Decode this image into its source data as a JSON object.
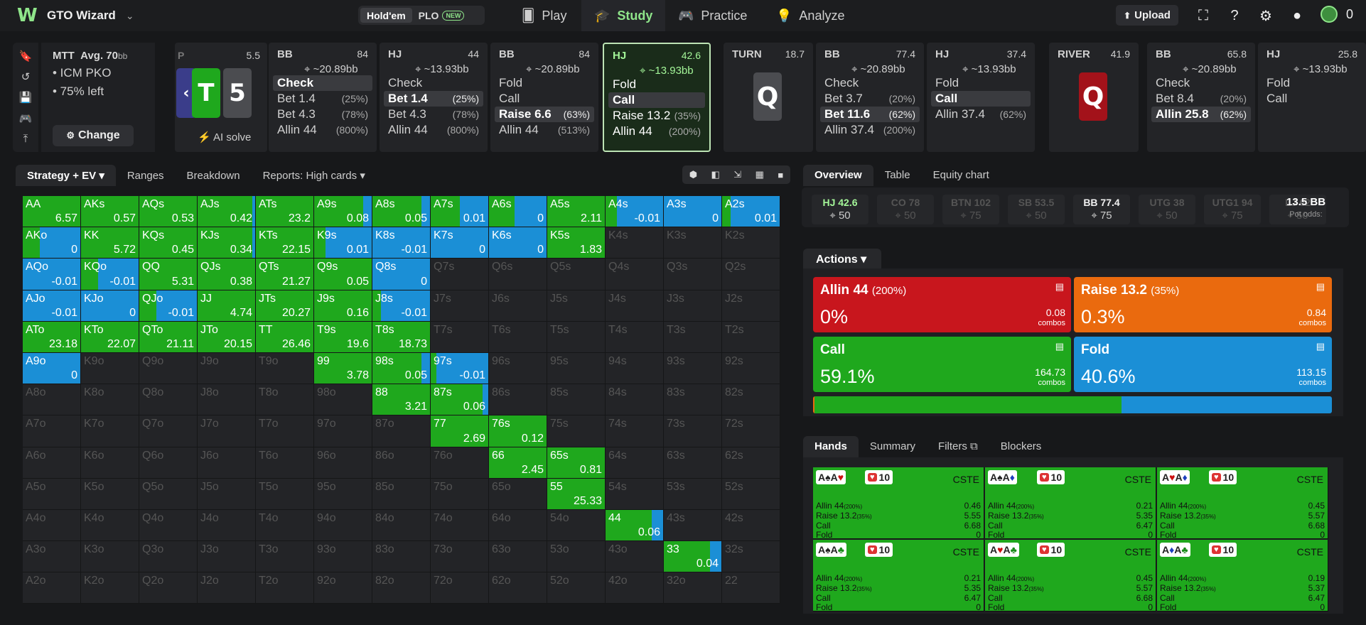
{
  "app": {
    "brand": "GTO Wizard",
    "game_toggle": [
      "Hold'em",
      "PLO"
    ],
    "new_badge": "NEW"
  },
  "nav": [
    {
      "label": "Play",
      "icon": "cards-icon"
    },
    {
      "label": "Study",
      "icon": "graduation-cap-icon"
    },
    {
      "label": "Practice",
      "icon": "gamepad-icon"
    },
    {
      "label": "Analyze",
      "icon": "lightbulb-icon"
    }
  ],
  "upload": "Upload",
  "coins": "0",
  "mtt": {
    "title": "MTT",
    "avg": "Avg. 70",
    "avg_unit": "bb",
    "line1": "• ICM PKO",
    "line2": "• 75% left",
    "change": "Change"
  },
  "flop": {
    "tag": "5.5",
    "p": "P",
    "cards": [
      "T",
      "5"
    ],
    "ai_solve": "AI solve"
  },
  "columns": [
    {
      "pos": "BB",
      "val": "84",
      "bb": "~20.89bb",
      "acts": [
        {
          "a": "Check",
          "p": "",
          "chosen": true
        },
        {
          "a": "Bet 1.4",
          "p": "(25%)"
        },
        {
          "a": "Bet 4.3",
          "p": "(78%)"
        },
        {
          "a": "Allin 44",
          "p": "(800%)"
        }
      ]
    },
    {
      "pos": "HJ",
      "val": "44",
      "bb": "~13.93bb",
      "acts": [
        {
          "a": "Check",
          "p": ""
        },
        {
          "a": "Bet 1.4",
          "p": "(25%)",
          "chosen": true
        },
        {
          "a": "Bet 4.3",
          "p": "(78%)"
        },
        {
          "a": "Allin 44",
          "p": "(800%)"
        }
      ]
    },
    {
      "pos": "BB",
      "val": "84",
      "bb": "~20.89bb",
      "acts": [
        {
          "a": "Fold",
          "p": ""
        },
        {
          "a": "Call",
          "p": ""
        },
        {
          "a": "Raise 6.6",
          "p": "(63%)",
          "chosen": true
        },
        {
          "a": "Allin 44",
          "p": "(513%)"
        }
      ]
    },
    {
      "pos": "HJ",
      "val": "42.6",
      "bb": "~13.93bb",
      "sel": true,
      "acts": [
        {
          "a": "Fold",
          "p": ""
        },
        {
          "a": "Call",
          "p": "",
          "chosen": true
        },
        {
          "a": "Raise 13.2",
          "p": "(35%)"
        },
        {
          "a": "Allin 44",
          "p": "(200%)"
        }
      ]
    }
  ],
  "turn": {
    "label": "TURN",
    "val": "18.7",
    "card": "Q"
  },
  "columns2": [
    {
      "pos": "BB",
      "val": "77.4",
      "bb": "~20.89bb",
      "acts": [
        {
          "a": "Check",
          "p": ""
        },
        {
          "a": "Bet 3.7",
          "p": "(20%)"
        },
        {
          "a": "Bet 11.6",
          "p": "(62%)",
          "chosen": true
        },
        {
          "a": "Allin 37.4",
          "p": "(200%)"
        }
      ]
    },
    {
      "pos": "HJ",
      "val": "37.4",
      "bb": "~13.93bb",
      "acts": [
        {
          "a": "Fold",
          "p": ""
        },
        {
          "a": "Call",
          "p": "",
          "chosen": true
        },
        {
          "a": "Allin 37.4",
          "p": "(62%)"
        }
      ]
    }
  ],
  "river": {
    "label": "RIVER",
    "val": "41.9",
    "card": "Q"
  },
  "columns3": [
    {
      "pos": "BB",
      "val": "65.8",
      "bb": "~20.89bb",
      "acts": [
        {
          "a": "Check",
          "p": ""
        },
        {
          "a": "Bet 8.4",
          "p": "(20%)"
        },
        {
          "a": "Allin 25.8",
          "p": "(62%)",
          "chosen": true
        }
      ]
    },
    {
      "pos": "HJ",
      "val": "25.8",
      "bb": "~13.93bb",
      "acts": [
        {
          "a": "Fold",
          "p": ""
        },
        {
          "a": "Call",
          "p": ""
        }
      ]
    }
  ],
  "left_tabs": [
    "Strategy + EV",
    "Ranges",
    "Breakdown",
    "Reports: High cards"
  ],
  "grid": {
    "ranks": [
      "A",
      "K",
      "Q",
      "J",
      "T",
      "9",
      "8",
      "7",
      "6",
      "5",
      "4",
      "3",
      "2"
    ],
    "cells": {
      "AA": [
        "6.57",
        1,
        0
      ],
      "AKs": [
        "0.57",
        1,
        0
      ],
      "AQs": [
        "0.53",
        1,
        0
      ],
      "AJs": [
        "0.42",
        0.95,
        0.05
      ],
      "ATs": [
        "23.2",
        1,
        0
      ],
      "A9s": [
        "0.08",
        0.85,
        0.15
      ],
      "A8s": [
        "0.05",
        0.85,
        0.15
      ],
      "A7s": [
        "0.01",
        0.5,
        0.5
      ],
      "A6s": [
        "0",
        0.45,
        0.55
      ],
      "A5s": [
        "2.11",
        1,
        0
      ],
      "A4s": [
        "-0.01",
        0.2,
        0.8
      ],
      "A3s": [
        "0",
        0,
        1
      ],
      "A2s": [
        "0.01",
        0.15,
        0.85
      ],
      "AKo": [
        "0",
        0.3,
        0.7
      ],
      "KK": [
        "5.72",
        1,
        0
      ],
      "KQs": [
        "0.45",
        1,
        0
      ],
      "KJs": [
        "0.34",
        0.95,
        0.05
      ],
      "KTs": [
        "22.15",
        1,
        0
      ],
      "K9s": [
        "0.01",
        0.2,
        0.8
      ],
      "K8s": [
        "-0.01",
        0,
        1
      ],
      "K7s": [
        "0",
        0,
        1
      ],
      "K6s": [
        "0",
        0,
        1
      ],
      "K5s": [
        "1.83",
        1,
        0
      ],
      "AQo": [
        "-0.01",
        0,
        1
      ],
      "KQo": [
        "-0.01",
        0.3,
        0.7
      ],
      "QQ": [
        "5.31",
        1,
        0
      ],
      "QJs": [
        "0.38",
        1,
        0
      ],
      "QTs": [
        "21.27",
        1,
        0
      ],
      "Q9s": [
        "0.05",
        1,
        0
      ],
      "Q8s": [
        "0",
        0,
        1
      ],
      "AJo": [
        "-0.01",
        0,
        1
      ],
      "KJo": [
        "0",
        0,
        1
      ],
      "QJo": [
        "-0.01",
        0.3,
        0.7
      ],
      "JJ": [
        "4.74",
        1,
        0
      ],
      "JTs": [
        "20.27",
        1,
        0
      ],
      "J9s": [
        "0.16",
        1,
        0
      ],
      "J8s": [
        "-0.01",
        0.15,
        0.85
      ],
      "ATo": [
        "23.18",
        1,
        0
      ],
      "KTo": [
        "22.07",
        1,
        0
      ],
      "QTo": [
        "21.11",
        1,
        0
      ],
      "JTo": [
        "20.15",
        1,
        0
      ],
      "TT": [
        "26.46",
        1,
        0
      ],
      "T9s": [
        "19.6",
        1,
        0
      ],
      "T8s": [
        "18.73",
        1,
        0
      ],
      "A9o": [
        "0",
        0,
        1
      ],
      "99": [
        "3.78",
        1,
        0
      ],
      "98s": [
        "0.05",
        0.85,
        0.15
      ],
      "97s": [
        "-0.01",
        0.1,
        0.9
      ],
      "88": [
        "3.21",
        1,
        0
      ],
      "87s": [
        "0.06",
        0.9,
        0.1
      ],
      "77": [
        "2.69",
        1,
        0
      ],
      "76s": [
        "0.12",
        1,
        0
      ],
      "66": [
        "2.45",
        1,
        0
      ],
      "65s": [
        "0.81",
        1,
        0
      ],
      "55": [
        "25.33",
        1,
        0
      ],
      "44": [
        "0.06",
        0.8,
        0.2
      ],
      "33": [
        "0.04",
        0.8,
        0.2
      ]
    }
  },
  "right_tabs": [
    "Overview",
    "Table",
    "Equity chart"
  ],
  "positions": [
    {
      "n": "HJ 42.6",
      "s": "50",
      "on": true,
      "hj": true
    },
    {
      "n": "CO 78",
      "s": "50"
    },
    {
      "n": "BTN 102",
      "s": "75"
    },
    {
      "n": "SB 53.5",
      "s": "50"
    },
    {
      "n": "BB 77.4",
      "s": "75",
      "on": true
    },
    {
      "n": "UTG 38",
      "s": "50"
    },
    {
      "n": "UTG1 94",
      "s": "75"
    },
    {
      "n": "LJ 62",
      "s": "50"
    }
  ],
  "pot_odds": {
    "value": "13.5 BB",
    "label": "Pot odds:"
  },
  "actions_label": "Actions",
  "actions": [
    {
      "name": "Allin 44",
      "pct_note": "(200%)",
      "freq": "0%",
      "combos": "0.08",
      "color": "#c8161d"
    },
    {
      "name": "Raise 13.2",
      "pct_note": "(35%)",
      "freq": "0.3%",
      "combos": "0.84",
      "color": "#ea6a0e"
    },
    {
      "name": "Call",
      "pct_note": "",
      "freq": "59.1%",
      "combos": "164.73",
      "color": "#1fa81d"
    },
    {
      "name": "Fold",
      "pct_note": "",
      "freq": "40.6%",
      "combos": "113.15",
      "color": "#1b8fd6"
    }
  ],
  "combos_word": "combos",
  "freq_bar": [
    {
      "color": "#ea6a0e",
      "frac": 0.003
    },
    {
      "color": "#1fa81d",
      "frac": 0.591
    },
    {
      "color": "#1b8fd6",
      "frac": 0.406
    }
  ],
  "hands_tabs": [
    "Hands",
    "Summary",
    "Filters",
    "Blockers"
  ],
  "hand_cards": [
    {
      "c1": "A",
      "s1": "♠",
      "k1": "",
      "c2": "A",
      "s2": "♥",
      "k2": "r",
      "vals": [
        "0.46",
        "5.55",
        "6.68",
        "0"
      ]
    },
    {
      "c1": "A",
      "s1": "♠",
      "k1": "",
      "c2": "A",
      "s2": "♦",
      "k2": "b",
      "vals": [
        "0.21",
        "5.35",
        "6.47",
        "0"
      ]
    },
    {
      "c1": "A",
      "s1": "♥",
      "k1": "r",
      "c2": "A",
      "s2": "♦",
      "k2": "b",
      "vals": [
        "0.45",
        "5.57",
        "6.68",
        "0"
      ]
    },
    {
      "c1": "A",
      "s1": "♠",
      "k1": "",
      "c2": "A",
      "s2": "♣",
      "k2": "g",
      "vals": [
        "0.21",
        "5.35",
        "6.47",
        "0"
      ]
    },
    {
      "c1": "A",
      "s1": "♥",
      "k1": "r",
      "c2": "A",
      "s2": "♣",
      "k2": "g",
      "vals": [
        "0.45",
        "5.57",
        "6.68",
        "0"
      ]
    },
    {
      "c1": "A",
      "s1": "♦",
      "k1": "b",
      "c2": "A",
      "s2": "♣",
      "k2": "g",
      "vals": [
        "0.19",
        "5.37",
        "6.47",
        "0"
      ]
    }
  ],
  "hand_rows": [
    "Allin 44",
    "Raise 13.2",
    "Call",
    "Fold"
  ],
  "hand_row_notes": [
    "(200%)",
    "(35%)",
    "",
    ""
  ],
  "blocker": "1",
  "blocker_zero": "0",
  "cste": "CSTE",
  "colors": {
    "call": "#1fa81d",
    "fold": "#1b8fd6",
    "accent": "#8fe58a"
  }
}
